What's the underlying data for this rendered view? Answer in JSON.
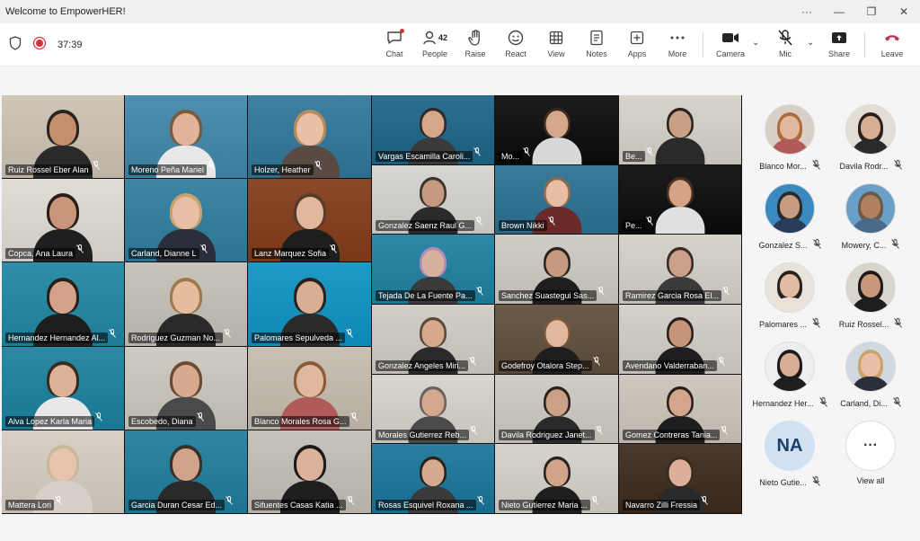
{
  "window": {
    "title": "Welcome to EmpowerHER!",
    "controls": {
      "more": "···",
      "minimize": "—",
      "restore": "❐",
      "close": "✕"
    }
  },
  "toolbar": {
    "timer": "37:39",
    "people_count": "42",
    "items": {
      "chat": "Chat",
      "people": "People",
      "raise": "Raise",
      "react": "React",
      "view": "View",
      "notes": "Notes",
      "apps": "Apps",
      "more": "More",
      "camera": "Camera",
      "mic": "Mic",
      "share": "Share",
      "leave": "Leave"
    }
  },
  "grid_tiles": [
    {
      "name": "Ruiz Rossel Eber Alan",
      "bg": "#cfc6b8",
      "skin": "#c58f6d",
      "hair": "#2b2320",
      "shirt": "#2a2a2a"
    },
    {
      "name": "Moreno Peña Mariel",
      "bg": "#4e8fb0",
      "skin": "#e0b49a",
      "hair": "#7a5a3a",
      "shirt": "#e8e8e8"
    },
    {
      "name": "Holzer, Heather",
      "bg": "#3f7fa0",
      "skin": "#e8c0a6",
      "hair": "#b58d5d",
      "shirt": "#5a4a44"
    },
    {
      "name": "Vargas Escamilla Caroli...",
      "bg": "#2d6f8e",
      "skin": "#d6a88a",
      "hair": "#2e2a28",
      "shirt": "#3a3a3a"
    },
    {
      "name": "Mo...",
      "bg": "#1c1c1c",
      "skin": "#d6a88a",
      "hair": "#3a2a20",
      "shirt": "#d8d8d8"
    },
    {
      "name": "Be...",
      "bg": "#d8d4cc",
      "skin": "#caa084",
      "hair": "#2a221e",
      "shirt": "#2a2a2a"
    },
    {
      "name": "Copca, Ana Laura",
      "bg": "#e0dcd6",
      "skin": "#c9957a",
      "hair": "#2a1c18",
      "shirt": "#1f1f1f"
    },
    {
      "name": "Carland, Dianne L",
      "bg": "#3d86a6",
      "skin": "#e8c0a8",
      "hair": "#c9a36a",
      "shirt": "#2a2f3a"
    },
    {
      "name": "Lanz Marquez Sofia",
      "bg": "#8a4a2a",
      "skin": "#e2b89c",
      "hair": "#5a3a2a",
      "shirt": "#1e1e1e"
    },
    {
      "name": "Gonzalez Saenz Raul G...",
      "bg": "#d8d6d2",
      "skin": "#c69a7e",
      "hair": "#3a3430",
      "shirt": "#2a2a2a"
    },
    {
      "name": "Brown Nikki",
      "bg": "#3a7a9a",
      "skin": "#e6bea4",
      "hair": "#8a6a4a",
      "shirt": "#6a2a2a"
    },
    {
      "name": "Pe...",
      "bg": "#1c1c1c",
      "skin": "#d4a488",
      "hair": "#4a2f20",
      "shirt": "#e0e0e0"
    },
    {
      "name": "Hernandez Hernandez Al...",
      "bg": "#2f8fa8",
      "skin": "#d4a288",
      "hair": "#2a1e1a",
      "shirt": "#1e1e1e"
    },
    {
      "name": "Rodriguez Guzman No...",
      "bg": "#c8c4bc",
      "skin": "#e4bc9e",
      "hair": "#9a7a4a",
      "shirt": "#2a2a2a"
    },
    {
      "name": "Palomares Sepulveda ...",
      "bg": "#1f9ac6",
      "skin": "#d8ae94",
      "hair": "#2a201c",
      "shirt": "#2a2a2a"
    },
    {
      "name": "Tejada De La Fuente Pa...",
      "bg": "#2e88a6",
      "skin": "#d8b0a0",
      "hair": "#b48ab8",
      "shirt": "#3a3a3a"
    },
    {
      "name": "Sanchez Suastegui Sas...",
      "bg": "#d0ccc6",
      "skin": "#c69a7e",
      "hair": "#2a221e",
      "shirt": "#1e1e1e"
    },
    {
      "name": "Ramirez Garcia Rosa El...",
      "bg": "#d6d2cc",
      "skin": "#caa088",
      "hair": "#3a2a22",
      "shirt": "#3a3a3a"
    },
    {
      "name": "Alva Lopez Karla Maria",
      "bg": "#2a8aa6",
      "skin": "#dcb298",
      "hair": "#3a2a22",
      "shirt": "#e8e8e8"
    },
    {
      "name": "Escobedo, Diana",
      "bg": "#cfcac2",
      "skin": "#d6aa8e",
      "hair": "#6a4a32",
      "shirt": "#4a4a4a"
    },
    {
      "name": "Blanco Morales Rosa G...",
      "bg": "#c9c0b4",
      "skin": "#e0b89e",
      "hair": "#8a5a3a",
      "shirt": "#b05a5a"
    },
    {
      "name": "Gonzalez Angeles Miri...",
      "bg": "#d2cec8",
      "skin": "#d6a88c",
      "hair": "#5a4a3a",
      "shirt": "#2a2a2a"
    },
    {
      "name": "Godefroy Otalora Step...",
      "bg": "#6a5a4a",
      "skin": "#e0b89e",
      "hair": "#7a5a3a",
      "shirt": "#1e1e1e"
    },
    {
      "name": "Avendano Valderraban...",
      "bg": "#d4d0ca",
      "skin": "#c69478",
      "hair": "#2a1e1a",
      "shirt": "#1e1e1e"
    },
    {
      "name": "Mattera Lori",
      "bg": "#d8d0c4",
      "skin": "#e8c4ac",
      "hair": "#c8b89a",
      "shirt": "#d8d0c8"
    },
    {
      "name": "Garcia Duran Cesar Ed...",
      "bg": "#2e86a2",
      "skin": "#d0a488",
      "hair": "#3a302a",
      "shirt": "#2a2a2a"
    },
    {
      "name": "Sifuentes Casas Katia ...",
      "bg": "#c8c2bc",
      "skin": "#dcb29a",
      "hair": "#1e1a18",
      "shirt": "#1e1e1e"
    },
    {
      "name": "Morales Gutierrez Reb...",
      "bg": "#d8d4ce",
      "skin": "#d4a88c",
      "hair": "#6a6060",
      "shirt": "#4a4a4a"
    },
    {
      "name": "Davila Rodriguez Janet...",
      "bg": "#d0ccc6",
      "skin": "#caa086",
      "hair": "#2a201c",
      "shirt": "#2a2a2a"
    },
    {
      "name": "Gomez Contreras Tania...",
      "bg": "#cfc8be",
      "skin": "#d2a68a",
      "hair": "#2a1e1a",
      "shirt": "#1e1e1e"
    },
    {
      "name": "",
      "bg": "#cfc8be",
      "skin": "#d2a68a",
      "hair": "#2a1e1a",
      "shirt": "#1e1e1e"
    },
    {
      "name": "Rosas Esquivel Roxana ...",
      "bg": "#2a7ea0",
      "skin": "#d6aa8e",
      "hair": "#2a201c",
      "shirt": "#3a3a3a"
    },
    {
      "name": "Nieto Gutierrez Maria ...",
      "bg": "#d6d2cc",
      "skin": "#d0a488",
      "hair": "#2a201c",
      "shirt": "#1e1e1e"
    },
    {
      "name": "Navarro Zilli Fressia",
      "bg": "#4a3a2e",
      "skin": "#dcb098",
      "hair": "#3a2a20",
      "shirt": "#2a2a2a"
    }
  ],
  "side_participants": [
    {
      "name": "Blanco Mor...",
      "skin": "#e0b89e",
      "hair": "#b06a3a",
      "shirt": "#b05a5a",
      "bg": "#d8d0c6"
    },
    {
      "name": "Davila Rodr...",
      "skin": "#d6ae92",
      "hair": "#2a201c",
      "shirt": "#2a2a2a",
      "bg": "#e2ddd6"
    },
    {
      "name": "Gonzalez S...",
      "skin": "#c89c80",
      "hair": "#2a2a2a",
      "shirt": "#2a3a5a",
      "bg": "#3a8ac0"
    },
    {
      "name": "Mowery, C...",
      "skin": "#b08060",
      "hair": "#6a5a4a",
      "shirt": "#4a6a8a",
      "bg": "#6aa0c8"
    },
    {
      "name": "Palomares ...",
      "skin": "#e2bca2",
      "hair": "#2a201c",
      "shirt": "#eae2d8",
      "bg": "#e6e2dc"
    },
    {
      "name": "Ruiz Rossel...",
      "skin": "#c8987a",
      "hair": "#1e1a18",
      "shirt": "#1e1e1e",
      "bg": "#d8d4ce"
    },
    {
      "name": "Hernandez Her...",
      "skin": "#d8ae94",
      "hair": "#1e1a18",
      "shirt": "#1e1e1e",
      "bg": "#eeeeee"
    },
    {
      "name": "Carland, Di...",
      "skin": "#e8c0a8",
      "hair": "#c9a36a",
      "shirt": "#2a2f3a",
      "bg": "#d0d8e0"
    }
  ],
  "nieto": {
    "initials": "NA",
    "name": "Nieto Gutie..."
  },
  "view_all": {
    "icon": "···",
    "label": "View all"
  }
}
